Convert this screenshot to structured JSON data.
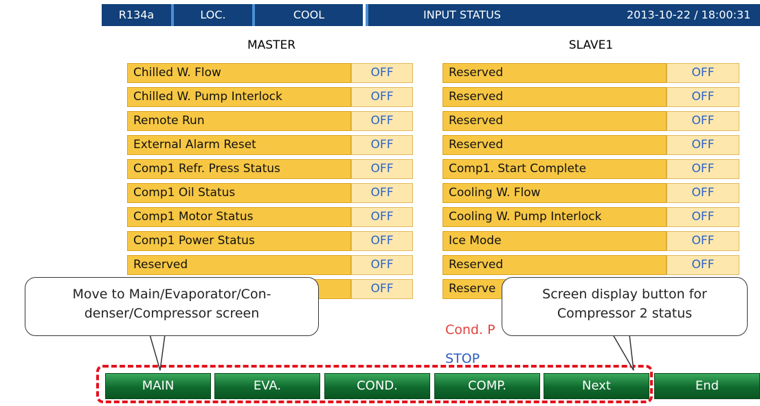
{
  "header": {
    "refrigerant": "R134a",
    "location": "LOC.",
    "mode": "COOL",
    "title": "INPUT STATUS",
    "datetime": "2013-10-22 / 18:00:31"
  },
  "master": {
    "title": "MASTER",
    "rows": [
      {
        "label": "Chilled W. Flow",
        "value": "OFF"
      },
      {
        "label": "Chilled W. Pump Interlock",
        "value": "OFF"
      },
      {
        "label": "Remote Run",
        "value": "OFF"
      },
      {
        "label": "External Alarm Reset",
        "value": "OFF"
      },
      {
        "label": "Comp1 Refr. Press Status",
        "value": "OFF"
      },
      {
        "label": "Comp1 Oil Status",
        "value": "OFF"
      },
      {
        "label": "Comp1 Motor Status",
        "value": "OFF"
      },
      {
        "label": "Comp1 Power Status",
        "value": "OFF"
      },
      {
        "label": "Reserved",
        "value": "OFF"
      },
      {
        "label": "",
        "value": "OFF"
      }
    ]
  },
  "slave": {
    "title": "SLAVE1",
    "rows": [
      {
        "label": "Reserved",
        "value": "OFF"
      },
      {
        "label": "Reserved",
        "value": "OFF"
      },
      {
        "label": "Reserved",
        "value": "OFF"
      },
      {
        "label": "Reserved",
        "value": "OFF"
      },
      {
        "label": "Comp1. Start Complete",
        "value": "OFF"
      },
      {
        "label": "Cooling W. Flow",
        "value": "OFF"
      },
      {
        "label": "Cooling W. Pump Interlock",
        "value": "OFF"
      },
      {
        "label": "Ice Mode",
        "value": "OFF"
      },
      {
        "label": "Reserved",
        "value": "OFF"
      },
      {
        "label": "Reserve",
        "value": ""
      }
    ]
  },
  "status": {
    "cond_text": "Cond. P",
    "run_text": "STOP"
  },
  "buttons": {
    "main": "MAIN",
    "eva": "EVA.",
    "cond": "COND.",
    "comp": "COMP.",
    "next": "Next",
    "end": "End"
  },
  "callouts": {
    "left_line1": "Move to Main/Evaporator/Con-",
    "left_line2": "denser/Compressor screen",
    "right_line1": "Screen display button for",
    "right_line2": "Compressor 2 status"
  },
  "colors": {
    "header_bg": "#11407a",
    "row_label_bg": "#f7c744",
    "row_value_bg": "#fde7ad",
    "value_text": "#2a63c9",
    "button_green": "#0f6a2e",
    "highlight_dash": "#e3121d"
  }
}
